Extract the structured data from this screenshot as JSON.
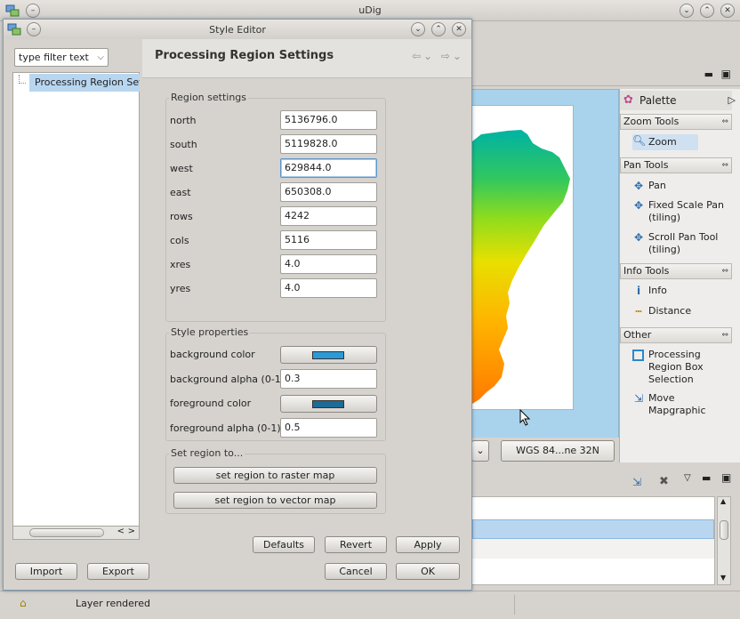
{
  "app": {
    "title": "uDig",
    "status_text": "Layer rendered"
  },
  "map": {
    "crs_label": "WGS 84...ne 32N"
  },
  "palette": {
    "title": "Palette",
    "drawers": [
      {
        "label": "Zoom Tools",
        "items": [
          "Zoom"
        ]
      },
      {
        "label": "Pan Tools",
        "items": [
          "Pan",
          "Fixed Scale Pan (tiling)",
          "Scroll Pan Tool (tiling)"
        ]
      },
      {
        "label": "Info Tools",
        "items": [
          "Info",
          "Distance"
        ]
      },
      {
        "label": "Other",
        "items": [
          "Processing Region Box Selection",
          "Move Mapgraphic"
        ]
      }
    ]
  },
  "dialog": {
    "title": "Style Editor",
    "filter_placeholder": "type filter text",
    "tree_item": "Processing Region Sett",
    "page_title": "Processing Region Settings",
    "region": {
      "legend": "Region settings",
      "fields": [
        {
          "label": "north",
          "value": "5136796.0"
        },
        {
          "label": "south",
          "value": "5119828.0"
        },
        {
          "label": "west",
          "value": "629844.0"
        },
        {
          "label": "east",
          "value": "650308.0"
        },
        {
          "label": "rows",
          "value": "4242"
        },
        {
          "label": "cols",
          "value": "5116"
        },
        {
          "label": "xres",
          "value": "4.0"
        },
        {
          "label": "yres",
          "value": "4.0"
        }
      ]
    },
    "style": {
      "legend": "Style properties",
      "background_color_label": "background color",
      "background_color": "#2b9ad6",
      "background_alpha_label": "background alpha (0-1)",
      "background_alpha": "0.3",
      "foreground_color_label": "foreground color",
      "foreground_color": "#1d6b97",
      "foreground_alpha_label": "foreground alpha (0-1)",
      "foreground_alpha": "0.5"
    },
    "set_region": {
      "legend": "Set region to...",
      "raster_button": "set region to raster map",
      "vector_button": "set region to vector map"
    },
    "buttons": {
      "defaults": "Defaults",
      "revert": "Revert",
      "apply": "Apply",
      "import": "Import",
      "export": "Export",
      "cancel": "Cancel",
      "ok": "OK"
    }
  }
}
